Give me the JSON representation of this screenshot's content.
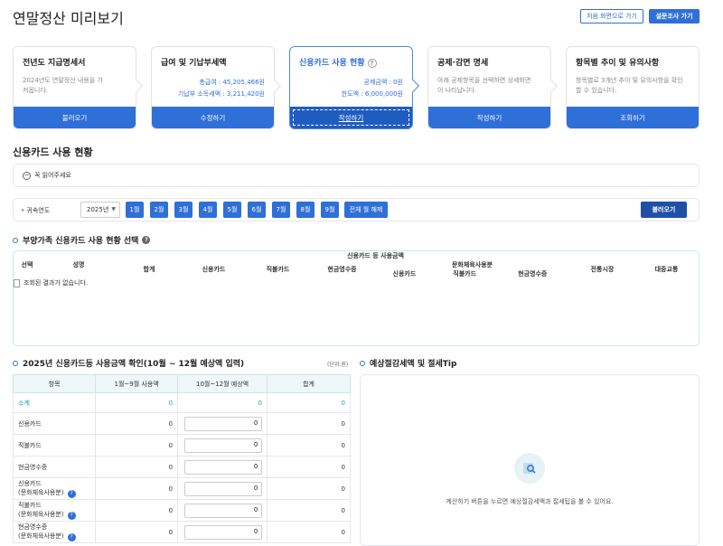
{
  "header": {
    "title": "연말정산 미리보기",
    "btn_first": "처음 화면으로 가기",
    "btn_survey": "설문조사 가기"
  },
  "steps": [
    {
      "title": "전년도 지급명세서",
      "desc": "2024년도 연말정산 내용을 가져옵니다.",
      "button": "불러오기"
    },
    {
      "title": "급여 및 기납부세액",
      "line1": "총급여 : 45,205,466원",
      "line2": "기납부 소득세액 : 3,211,420원",
      "button": "수정하기"
    },
    {
      "title": "신용카드 사용 현황",
      "line1": "공제금액 : 0원",
      "line2": "한도액 : 6,000,000원",
      "button": "작성하기"
    },
    {
      "title": "공제·감면 명세",
      "desc": "아래 공제항목을 선택하면 상세화면이 나타납니다.",
      "button": "작성하기"
    },
    {
      "title": "항목별 추이 및 유의사항",
      "desc": "항목별로 3개년 추이 및 유의사항을 확인할 수 있습니다.",
      "button": "조회하기"
    }
  ],
  "section": {
    "title": "신용카드 사용 현황",
    "notice": "꼭 읽어주세요"
  },
  "year_bar": {
    "label": "귀속연도",
    "year": "2025년",
    "months": [
      "1월",
      "2월",
      "3월",
      "4월",
      "5월",
      "6월",
      "7월",
      "8월",
      "9월"
    ],
    "all_toggle": "전체 월 해제",
    "load": "불러오기"
  },
  "dependents": {
    "title": "부양가족 신용카드 사용 현황 선택",
    "col_select": "선택",
    "col_name": "성명",
    "group_usage": "신용카드 등 사용금액",
    "col_total": "합계",
    "col_credit": "신용카드",
    "col_debit": "직불카드",
    "col_cash": "현금영수증",
    "group_culture": "문화체육사용분",
    "col_market": "전통시장",
    "col_transit": "대중교통",
    "empty": "조회된 결과가 없습니다."
  },
  "amounts": {
    "title": "2025년 신용카드등 사용금액 확인(10월 ~ 12월 예상액 입력)",
    "unit": "(단위:원)",
    "headers": [
      "항목",
      "1월~9월 사용액",
      "10월~12월 예상액",
      "합계"
    ],
    "rows": [
      {
        "label": "소계",
        "a": "0",
        "b": "0",
        "c": "0"
      },
      {
        "label": "신용카드",
        "a": "0",
        "b": "0",
        "c": "0"
      },
      {
        "label": "직불카드",
        "a": "0",
        "b": "0",
        "c": "0"
      },
      {
        "label": "현금영수증",
        "a": "0",
        "b": "0",
        "c": "0"
      },
      {
        "label": "신용카드",
        "label2": "(문화체육사용분)",
        "a": "0",
        "b": "0",
        "c": "0"
      },
      {
        "label": "직불카드",
        "label2": "(문화체육사용분)",
        "a": "0",
        "b": "0",
        "c": "0"
      },
      {
        "label": "현금영수증",
        "label2": "(문화체육사용분)",
        "a": "0",
        "b": "0",
        "c": "0"
      }
    ]
  },
  "tip": {
    "title": "예상절감세액 및 절세Tip",
    "message": "계산하기 버튼을 누르면 예상절감세액과 절세팁을 볼 수 있어요."
  }
}
